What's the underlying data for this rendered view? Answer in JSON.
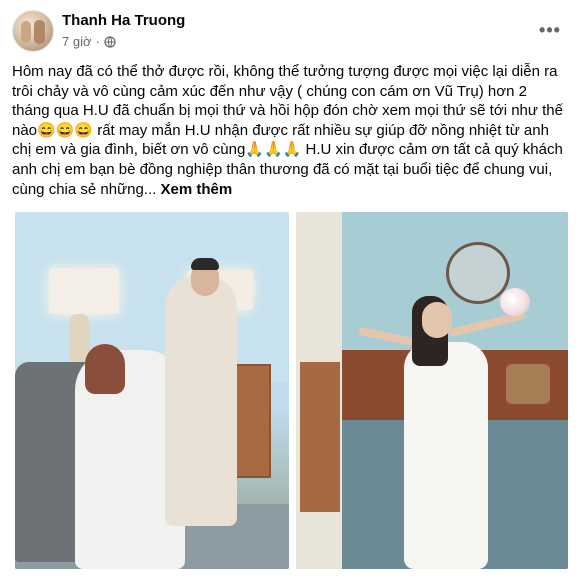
{
  "post": {
    "author": "Thanh Ha Truong",
    "time": "7 giờ",
    "separator": "·",
    "audience_icon": "globe-icon",
    "more_label": "•••",
    "text": "Hôm nay đã có thể thở được rồi, không thể tưởng tượng được mọi việc lại diễn ra trôi chảy và vô cùng cảm xúc đến như vậy ( chúng con cám ơn Vũ Trụ) hơn 2 tháng qua H.U đã chuẩn bị mọi thứ và hồi hộp đón chờ xem mọi thứ sẽ tới như thế nào😄😄😄 rất may mắn H.U nhận được rất nhiều sự giúp đỡ nồng nhiệt từ anh chị em và gia đình, biết ơn vô cùng🙏🙏🙏 H.U xin được cảm ơn tất cả quý khách anh chị em bạn bè đồng nghiệp thân thương đã có mặt tại buổi tiệc để chung vui, cùng chia sẻ những...",
    "see_more": "Xem thêm"
  },
  "colors": {
    "text": "#050505",
    "secondary": "#65676b"
  }
}
